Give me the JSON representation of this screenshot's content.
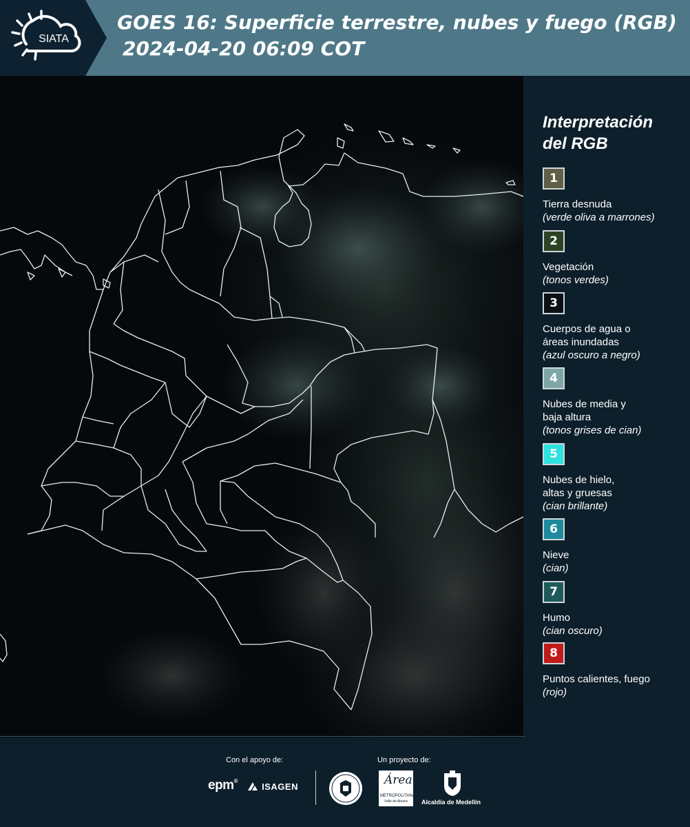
{
  "header": {
    "logo_text": "SIATA",
    "title_line1": "GOES 16: Superficie terrestre, nubes y fuego (RGB)",
    "title_line2": "2024-04-20 06:09 COT"
  },
  "legend": {
    "title_line1": "Interpretación",
    "title_line2": "del RGB",
    "items": [
      {
        "number": "1",
        "name": "Tierra desnuda",
        "desc": "(verde oliva a marrones)",
        "color": "#5f5f47"
      },
      {
        "number": "2",
        "name": "Vegetación",
        "desc": "(tonos verdes)",
        "color": "#2d4225"
      },
      {
        "number": "3",
        "name": "Cuerpos de agua o áreas inundadas",
        "desc": "(azul oscuro a negro)",
        "color": "#0b1014"
      },
      {
        "number": "4",
        "name": "Nubes de media y baja altura",
        "desc": "(tonos grises de cian)",
        "color": "#7fa6a6"
      },
      {
        "number": "5",
        "name": "Nubes de hielo, altas y gruesas",
        "desc": "(cian brillante)",
        "color": "#2ee2e0"
      },
      {
        "number": "6",
        "name": "Nieve",
        "desc": "(cian)",
        "color": "#1e8a9e"
      },
      {
        "number": "7",
        "name": "Humo",
        "desc": "(cian oscuro)",
        "color": "#1f5a5a"
      },
      {
        "number": "8",
        "name": "Puntos calientes, fuego",
        "desc": "(rojo)",
        "color": "#c11a1a"
      }
    ]
  },
  "footer": {
    "support_label": "Con el apoyo de:",
    "project_label": "Un proyecto de:",
    "epm": "epm",
    "isagen": "ISAGEN",
    "area_line1": "METROPOLITANA",
    "area_line2": "Valle de Aburrá",
    "area_script": "Área",
    "alcaldia": "Alcaldía de Medellín"
  }
}
